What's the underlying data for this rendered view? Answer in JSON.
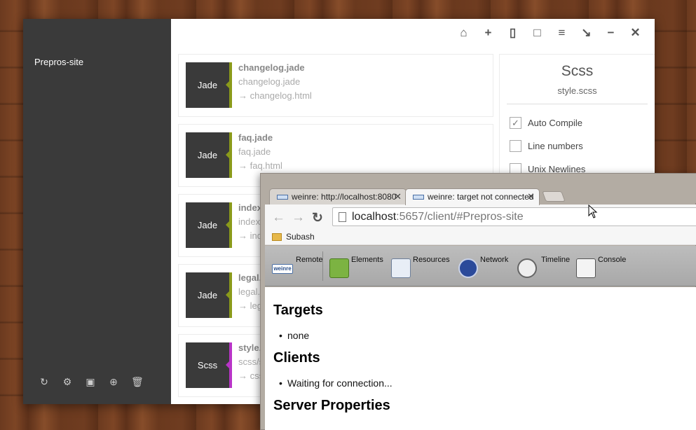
{
  "prepros": {
    "project_name": "Prepros-site",
    "topbar_icons": [
      "home-icon",
      "plus-icon",
      "mobile-icon",
      "clipboard-icon",
      "menu-icon",
      "arrow-down-right-icon",
      "minimize-icon",
      "close-icon"
    ],
    "sidebar_tools": [
      "refresh-icon",
      "gear-icon",
      "image-icon",
      "globe-icon",
      "trash-icon"
    ],
    "files": [
      {
        "type": "Jade",
        "name": "changelog.jade",
        "path": "changelog.jade",
        "output": "→ changelog.html"
      },
      {
        "type": "Jade",
        "name": "faq.jade",
        "path": "faq.jade",
        "output": "→ faq.html"
      },
      {
        "type": "Jade",
        "name": "index.jade",
        "path": "index.jade",
        "output": "→ index.html"
      },
      {
        "type": "Jade",
        "name": "legal.jade",
        "path": "legal.jade",
        "output": "→ legal.html"
      },
      {
        "type": "Scss",
        "name": "style.scss",
        "path": "scss/style.scss",
        "output": "→ css/style.css"
      }
    ],
    "options": {
      "title": "Scss",
      "subtitle": "style.scss",
      "items": [
        {
          "label": "Auto Compile",
          "checked": true
        },
        {
          "label": "Line numbers",
          "checked": false
        },
        {
          "label": "Unix Newlines",
          "checked": false
        }
      ]
    },
    "colors": {
      "jade_accent": "#8a9a1a",
      "scss_accent": "#b834c7",
      "sidebar": "#3a3a3a"
    }
  },
  "chrome": {
    "tabs": [
      {
        "title": "weinre: http://localhost:8080",
        "active": false
      },
      {
        "title": "weinre: target not connected",
        "active": true
      }
    ],
    "url_host": "localhost",
    "url_rest": ":5657/client/#Prepros-site",
    "bookmark": "Subash",
    "weinre_tools": [
      "Remote",
      "Elements",
      "Resources",
      "Network",
      "Timeline",
      "Console"
    ],
    "remote_badge": "weinre",
    "sections": [
      {
        "heading": "Targets",
        "items": [
          "none"
        ]
      },
      {
        "heading": "Clients",
        "items": [
          "Waiting for connection..."
        ]
      },
      {
        "heading": "Server Properties",
        "items": []
      }
    ]
  }
}
